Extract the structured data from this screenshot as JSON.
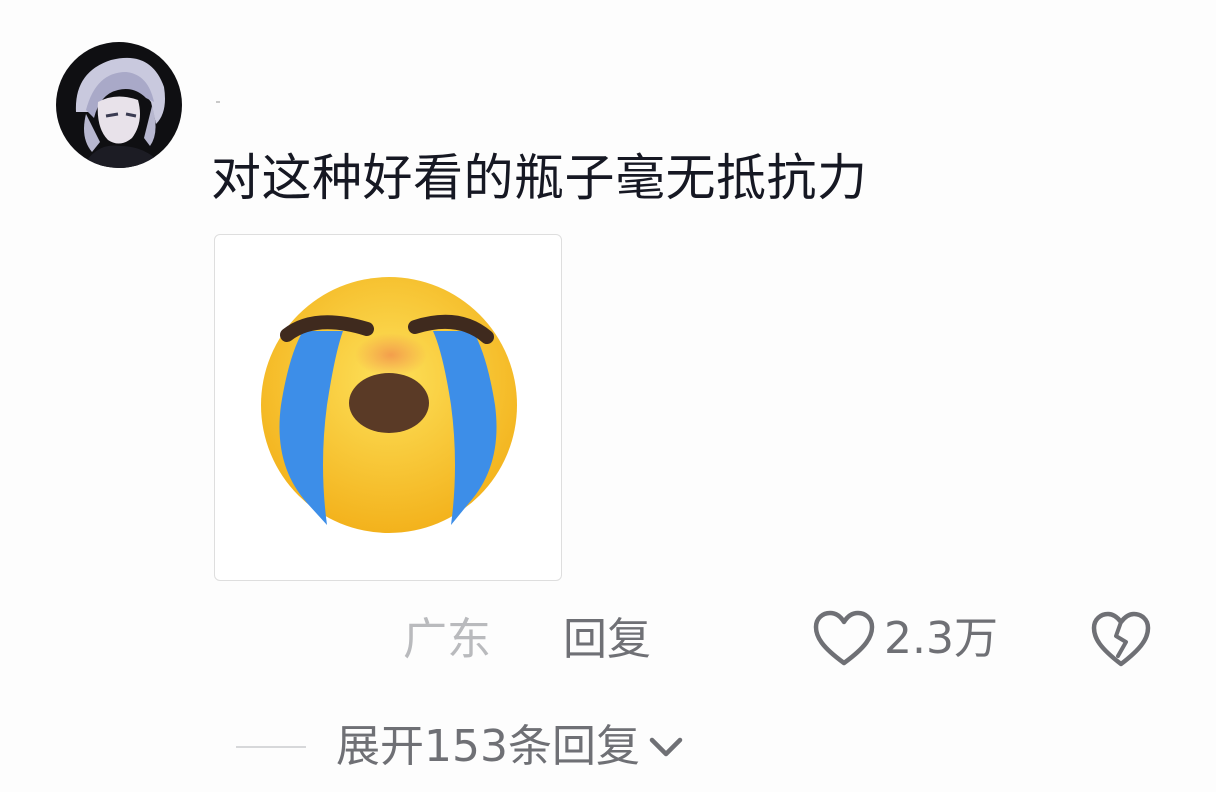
{
  "comment": {
    "avatar_icon": "anime-avatar-icon",
    "text": "对这种好看的瓶子毫无抵抗力",
    "sticker_icon": "loudly-crying-face-icon",
    "location": "广东",
    "reply_label": "回复",
    "like_icon": "heart-outline-icon",
    "like_count": "2.3万",
    "dislike_icon": "broken-heart-icon"
  },
  "replies": {
    "expand_label": "展开153条回复",
    "chevron_icon": "chevron-down-icon"
  },
  "colors": {
    "text_primary": "#161823",
    "text_secondary": "#6f7075",
    "text_muted": "#b9babd",
    "face_yellow": "#f9c72c",
    "tear_blue": "#3d8ee8"
  }
}
